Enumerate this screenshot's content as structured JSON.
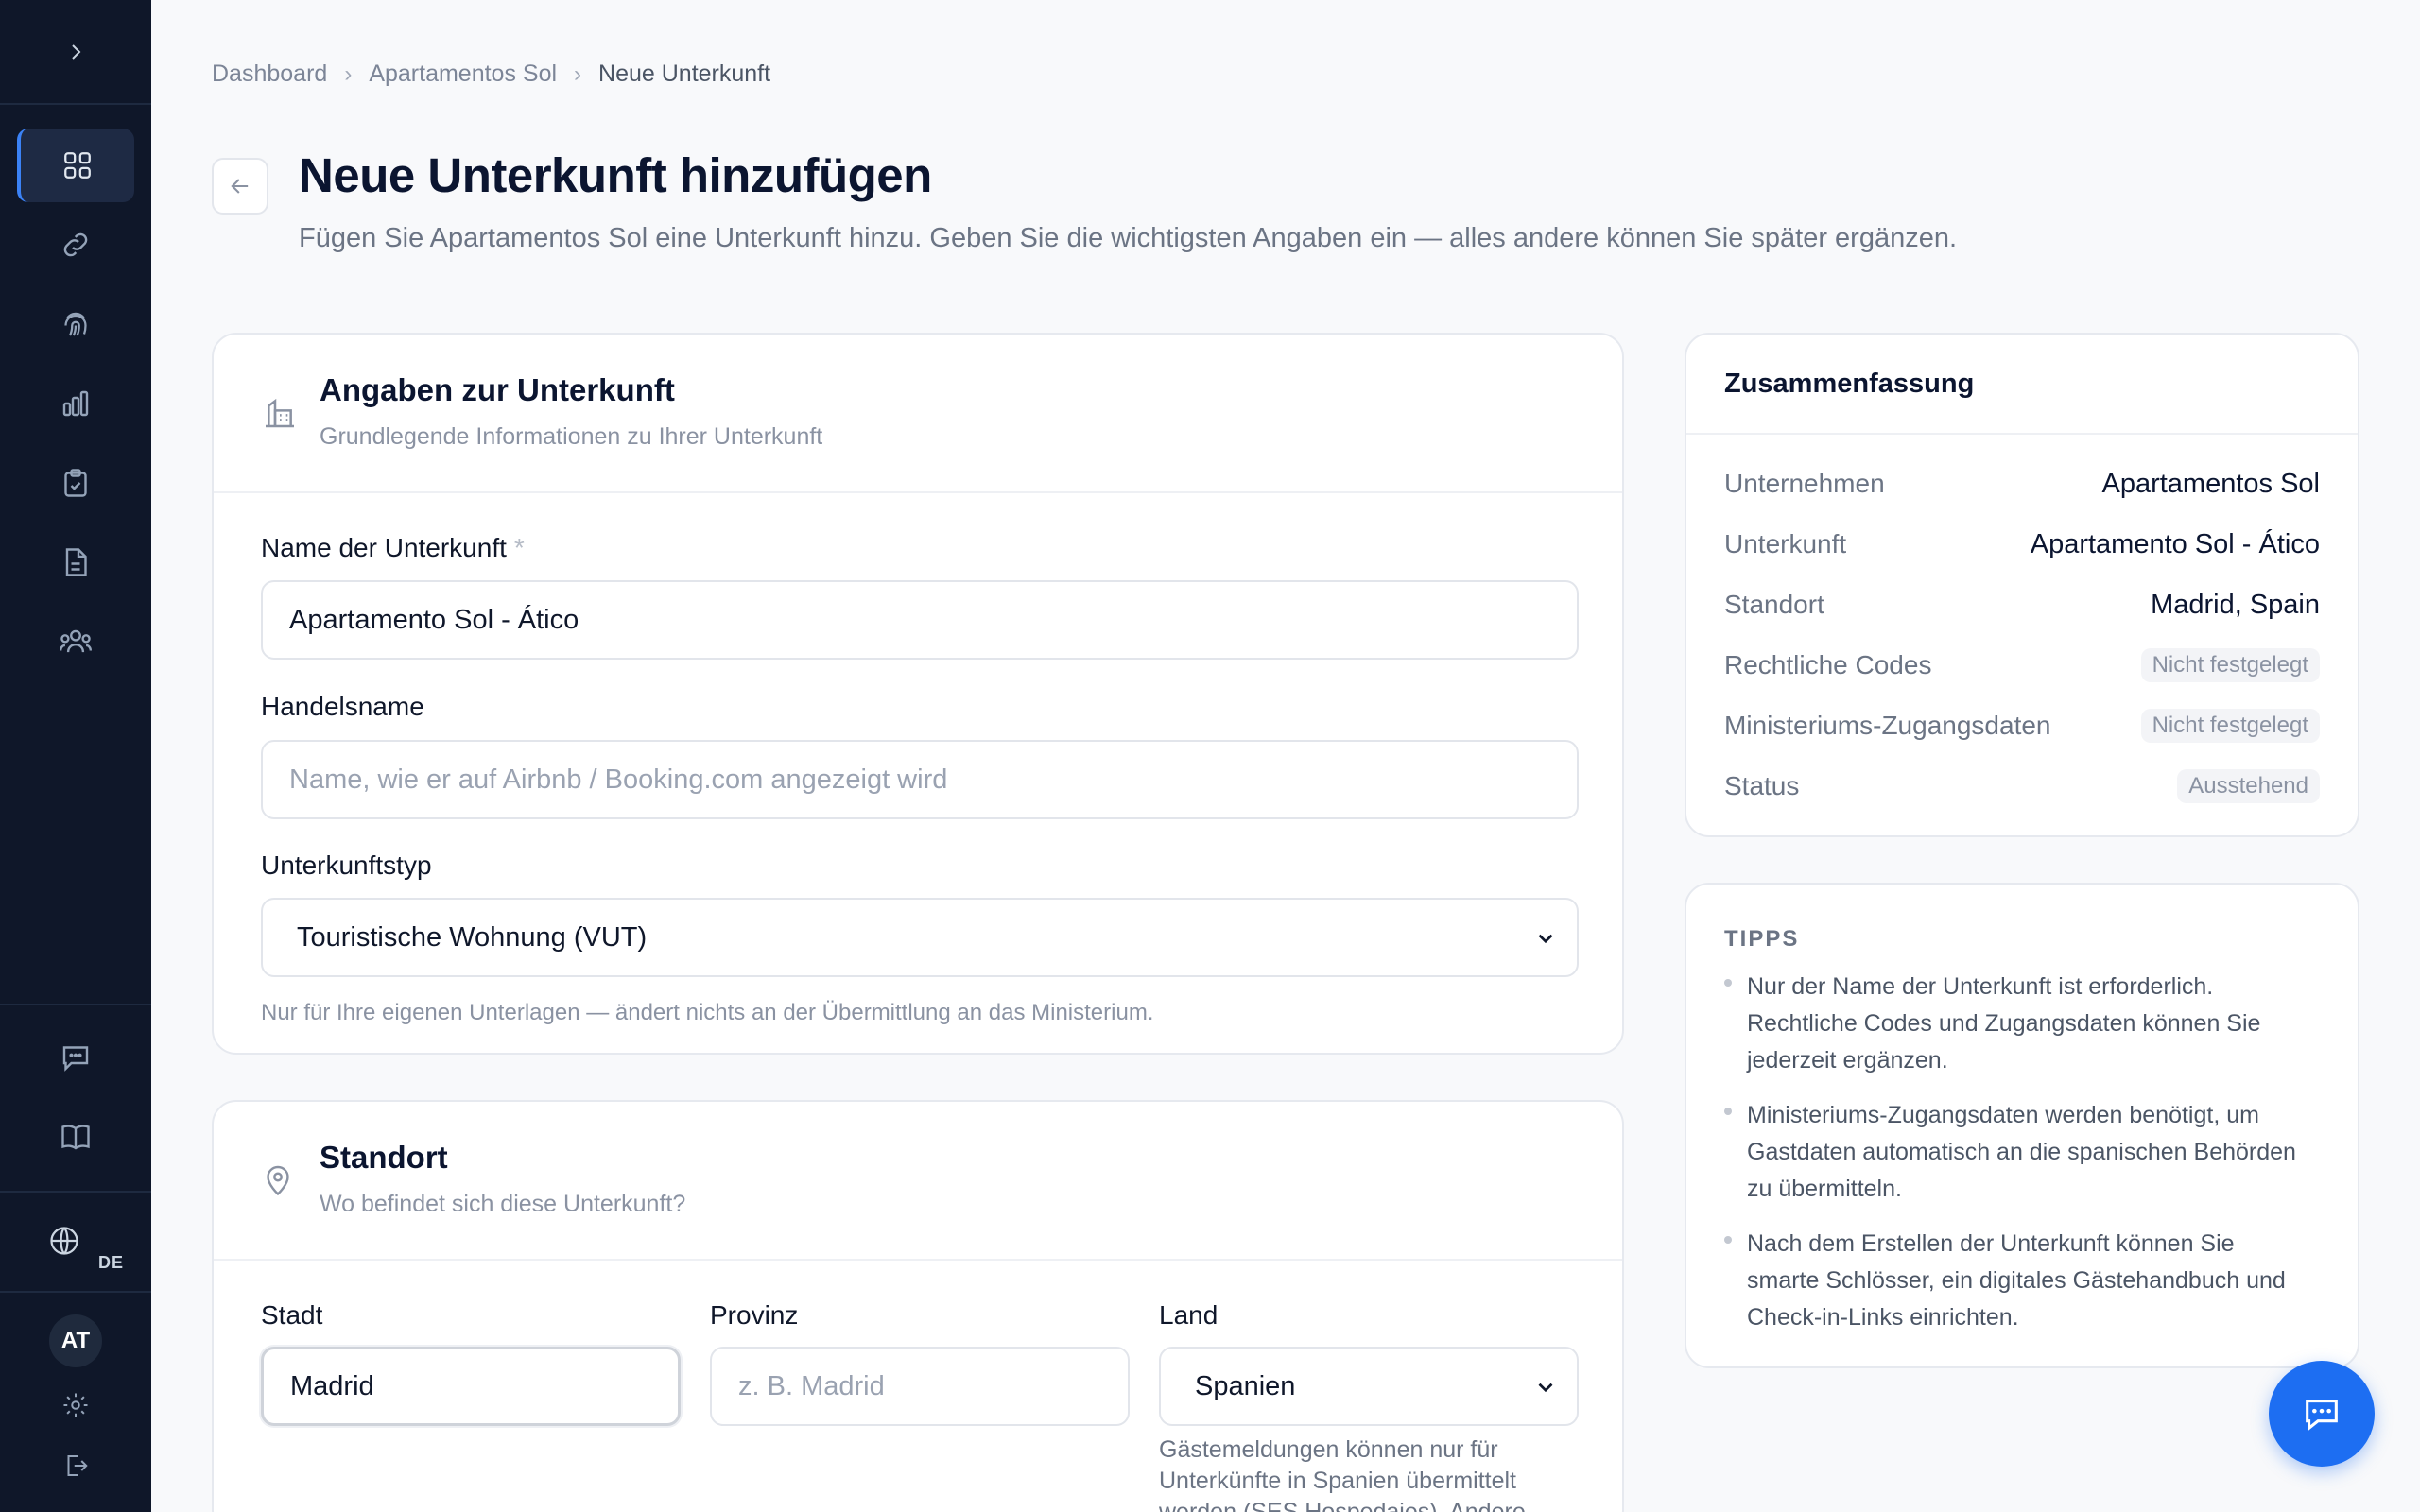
{
  "language": "DE",
  "user_initials": "AT",
  "breadcrumb": [
    "Dashboard",
    "Apartamentos Sol",
    "Neue Unterkunft"
  ],
  "header": {
    "title": "Neue Unterkunft hinzufügen",
    "subtitle": "Fügen Sie Apartamentos Sol eine Unterkunft hinzu. Geben Sie die wichtigsten Angaben ein — alles andere können Sie später ergänzen."
  },
  "details_card": {
    "title": "Angaben zur Unterkunft",
    "subtitle": "Grundlegende Informationen zu Ihrer Unterkunft",
    "name_label": "Name der Unterkunft",
    "name_required": "*",
    "name_value": "Apartamento Sol - Ático",
    "trade_label": "Handelsname",
    "trade_placeholder": "Name, wie er auf Airbnb / Booking.com angezeigt wird",
    "type_label": "Unterkunftstyp",
    "type_value": "Touristische Wohnung (VUT)",
    "type_hint": "Nur für Ihre eigenen Unterlagen — ändert nichts an der Übermittlung an das Ministerium."
  },
  "location_card": {
    "title": "Standort",
    "subtitle": "Wo befindet sich diese Unterkunft?",
    "city_label": "Stadt",
    "city_value": "Madrid",
    "province_label": "Provinz",
    "province_placeholder": "z. B. Madrid",
    "country_label": "Land",
    "country_value": "Spanien",
    "country_hint_1": "Gästemeldungen können nur für",
    "country_hint_2": "Unterkünfte in Spanien übermittelt",
    "country_hint_3": "werden (SES.Hospedajes). Andere"
  },
  "summary": {
    "title": "Zusammenfassung",
    "rows": [
      {
        "key": "Unternehmen",
        "value": "Apartamentos Sol"
      },
      {
        "key": "Unterkunft",
        "value": "Apartamento Sol - Ático"
      },
      {
        "key": "Standort",
        "value": "Madrid, Spain"
      },
      {
        "key": "Rechtliche Codes",
        "value": "Nicht festgelegt"
      },
      {
        "key": "Ministeriums-Zugangsdaten",
        "value": "Nicht festgelegt"
      },
      {
        "key": "Status",
        "value": "Ausstehend"
      }
    ]
  },
  "tips": {
    "title": "TIPPS",
    "items": [
      "Nur der Name der Unterkunft ist erforderlich. Rechtliche Codes und Zugangsdaten können Sie jederzeit ergänzen.",
      "Ministeriums-Zugangsdaten werden benötigt, um Gastdaten automatisch an die spanischen Behörden zu übermitteln.",
      "Nach dem Erstellen der Unterkunft können Sie smarte Schlösser, ein digitales Gästehandbuch und Check-in-Links einrichten."
    ]
  },
  "icons": {
    "sidebar": [
      "chevron-right-icon",
      "grid-icon",
      "link-icon",
      "fingerprint-icon",
      "bar-chart-icon",
      "clipboard-check-icon",
      "document-icon",
      "users-icon",
      "message-icon",
      "book-icon",
      "globe-icon",
      "gear-icon",
      "logout-icon"
    ]
  },
  "colors": {
    "sidebar": "#0f1729",
    "accent": "#1d6ef2"
  }
}
